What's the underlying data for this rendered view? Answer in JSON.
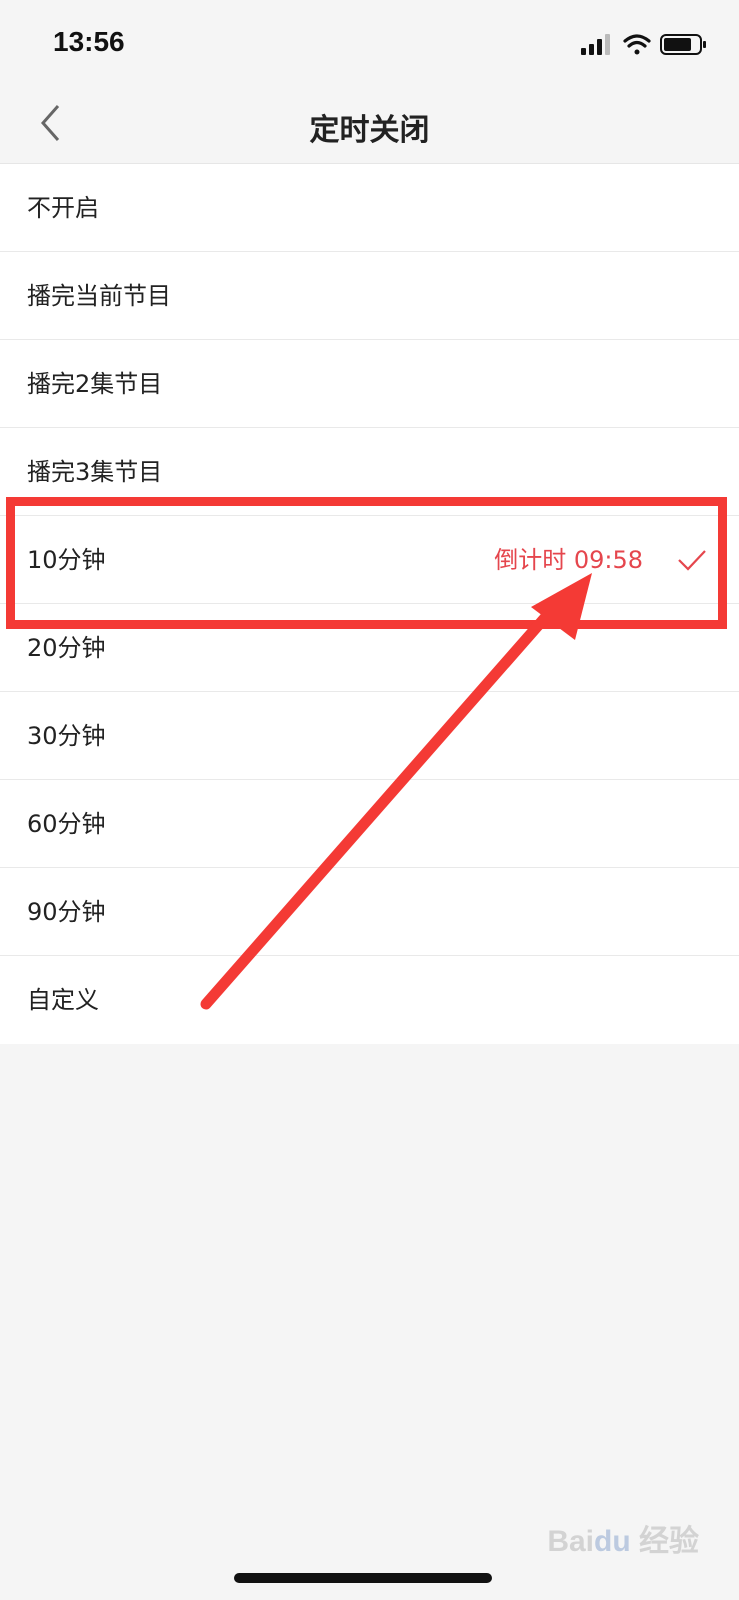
{
  "status_bar": {
    "time": "13:56"
  },
  "nav": {
    "title": "定时关闭"
  },
  "list": {
    "items": [
      {
        "label": "不开启"
      },
      {
        "label": "播完当前节目"
      },
      {
        "label": "播完2集节目"
      },
      {
        "label": "播完3集节目"
      },
      {
        "label": "10分钟",
        "countdown": "倒计时 09:58",
        "selected": true
      },
      {
        "label": "20分钟"
      },
      {
        "label": "30分钟"
      },
      {
        "label": "60分钟"
      },
      {
        "label": "90分钟"
      },
      {
        "label": "自定义"
      }
    ]
  },
  "colors": {
    "accent": "#e5464d",
    "annotation": "#f43a35",
    "background": "#f5f5f5"
  },
  "watermark": "Bai 经验"
}
